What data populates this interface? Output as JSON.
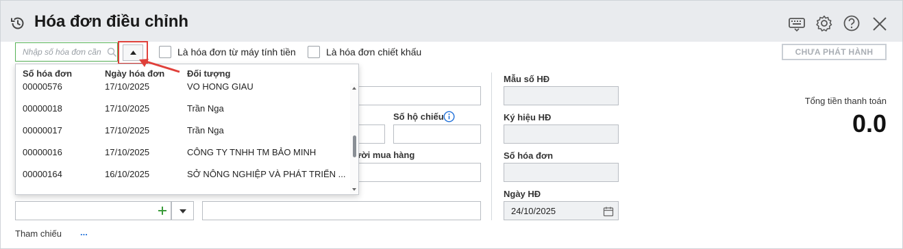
{
  "window": {
    "title": "Hóa đơn điều chỉnh",
    "icons": [
      "history-icon",
      "keyboard-icon",
      "gear-icon",
      "help-icon",
      "close-icon"
    ]
  },
  "search": {
    "placeholder": "Nhập số hóa đơn cần"
  },
  "options": {
    "from_cash_register": "Là hóa đơn từ máy tính tiền",
    "discount_invoice": "Là hóa đơn chiết khấu"
  },
  "status_button": "CHƯA PHÁT HÀNH",
  "dropdown": {
    "columns": [
      "Số hóa đơn",
      "Ngày hóa đơn",
      "Đối tượng"
    ],
    "rows": [
      {
        "number": "00000576",
        "date": "17/10/2025",
        "party": "VO HONG GIAU"
      },
      {
        "number": "00000018",
        "date": "17/10/2025",
        "party": "Trần Nga"
      },
      {
        "number": "00000017",
        "date": "17/10/2025",
        "party": "Trần Nga"
      },
      {
        "number": "00000016",
        "date": "17/10/2025",
        "party": "CÔNG TY TNHH TM BẢO MINH"
      },
      {
        "number": "00000164",
        "date": "16/10/2025",
        "party": "SỞ NÔNG NGHIỆP VÀ PHÁT TRIỂN ..."
      }
    ]
  },
  "form": {
    "passport_label": "Số hộ chiếu",
    "buyer_label_partial": "ười mua hàng",
    "reference_label": "Tham chiếu",
    "reference_link": "..."
  },
  "invoice_info": {
    "template_label": "Mẫu số HĐ",
    "symbol_label": "Ký hiệu HĐ",
    "number_label": "Số hóa đơn",
    "date_label": "Ngày HĐ",
    "date_value": "24/10/2025"
  },
  "totals": {
    "label": "Tổng tiền thanh toán",
    "value": "0.0"
  },
  "colors": {
    "accent_green": "#3a9b3a",
    "highlight_red": "#e0403a",
    "info_blue": "#1e6fd9"
  }
}
